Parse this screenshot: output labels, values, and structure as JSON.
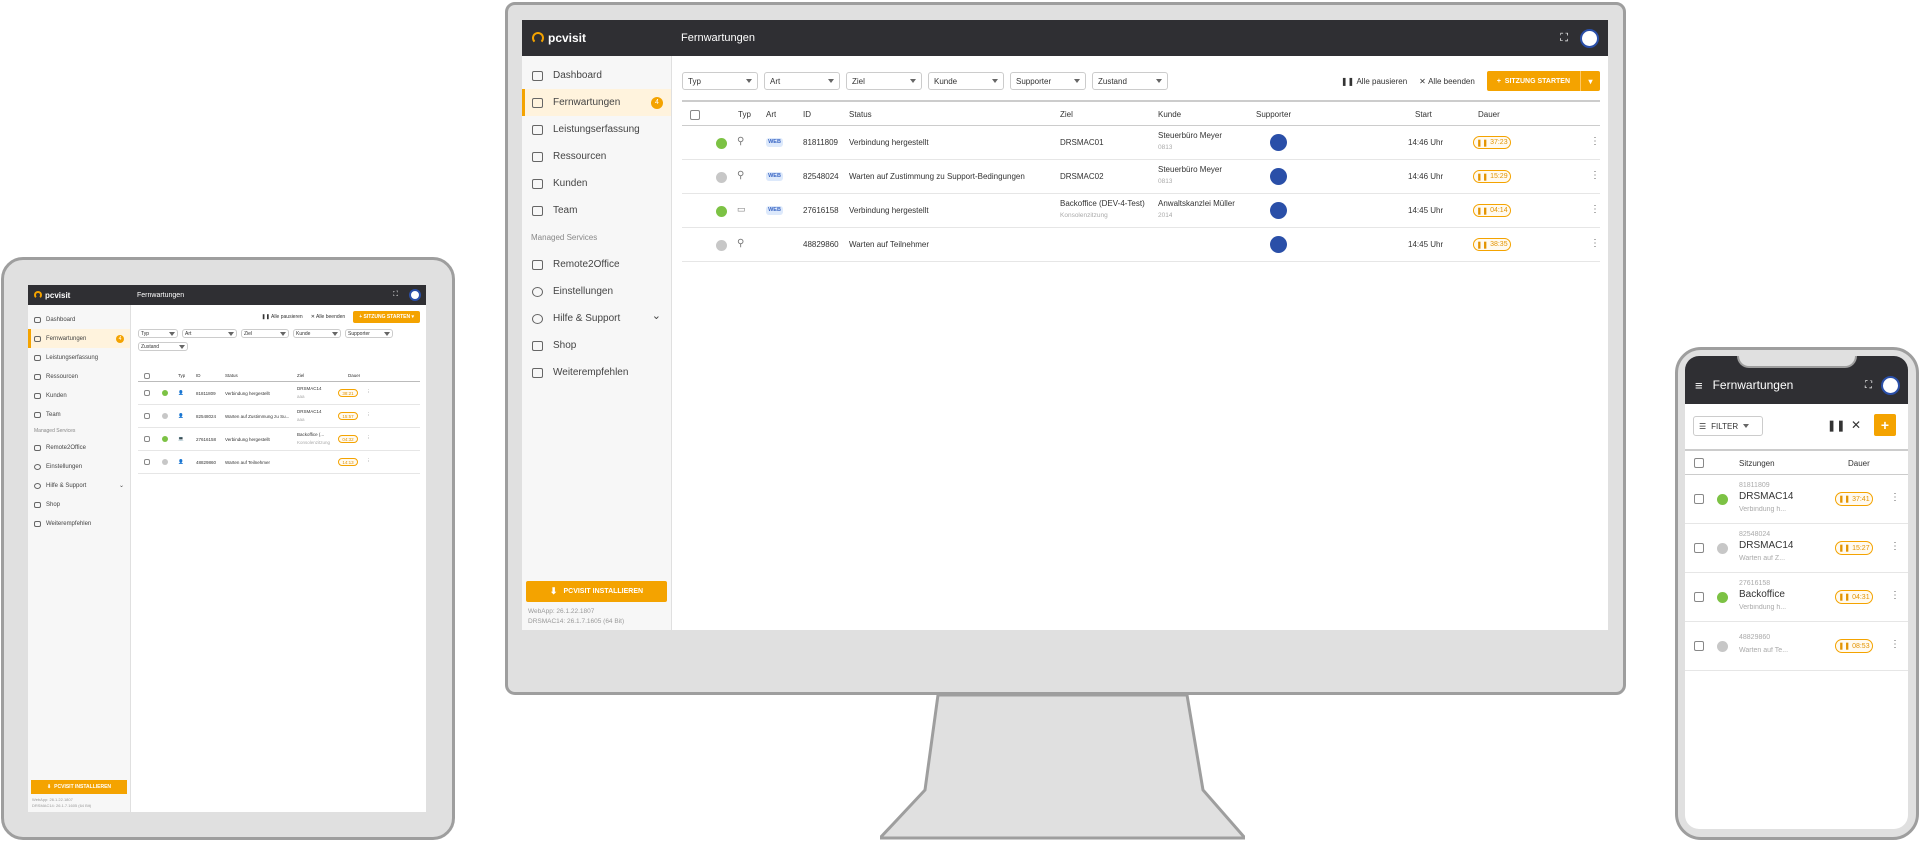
{
  "brand": {
    "name": "pcvisit",
    "accent": "#f4a300",
    "dark": "#2f2f33",
    "online": "#7cc244"
  },
  "page_title": "Fernwartungen",
  "nav": {
    "items": [
      {
        "label": "Dashboard",
        "icon": "dashboard-icon"
      },
      {
        "label": "Fernwartungen",
        "icon": "remote-icon",
        "badge": "4",
        "active": true
      },
      {
        "label": "Leistungserfassung",
        "icon": "timesheet-icon"
      },
      {
        "label": "Ressourcen",
        "icon": "resources-icon"
      },
      {
        "label": "Kunden",
        "icon": "customers-icon"
      },
      {
        "label": "Team",
        "icon": "team-icon"
      }
    ],
    "section_label": "Managed Services",
    "items2": [
      {
        "label": "Remote2Office",
        "icon": "monitor-icon"
      },
      {
        "label": "Einstellungen",
        "icon": "gear-icon"
      },
      {
        "label": "Hilfe & Support",
        "icon": "help-icon"
      },
      {
        "label": "Shop",
        "icon": "cart-icon"
      },
      {
        "label": "Weiterempfehlen",
        "icon": "thumbs-up-icon"
      }
    ],
    "install_button": "PCVISIT INSTALLIEREN",
    "version_line1": "WebApp: 26.1.22.1807",
    "version_line2": "DRSMAC14: 26.1.7.1605 (64 Bit)"
  },
  "filters": {
    "typ": "Typ",
    "art": "Art",
    "ziel": "Ziel",
    "kunde": "Kunde",
    "supporter": "Supporter",
    "zustand": "Zustand"
  },
  "actions": {
    "pause_all": "Alle pausieren",
    "end_all": "Alle beenden",
    "start": "SITZUNG STARTEN"
  },
  "table": {
    "headers": {
      "typ": "Typ",
      "art": "Art",
      "id": "ID",
      "status": "Status",
      "ziel": "Ziel",
      "kunde": "Kunde",
      "supporter": "Supporter",
      "start": "Start",
      "dauer": "Dauer"
    },
    "rows": [
      {
        "state": "online",
        "art": "WEB",
        "id": "81811809",
        "status": "Verbindung hergestellt",
        "ziel": "DRSMAC01",
        "ziel_sub": "",
        "kunde": "Steuerbüro Meyer",
        "kunde_sub": "0813",
        "start": "14:46 Uhr",
        "dauer": "37:23"
      },
      {
        "state": "waiting",
        "art": "WEB",
        "id": "82548024",
        "status": "Warten auf Zustimmung zu Support-Bedingungen",
        "ziel": "DRSMAC02",
        "ziel_sub": "",
        "kunde": "Steuerbüro Meyer",
        "kunde_sub": "0813",
        "start": "14:46 Uhr",
        "dauer": "15:29"
      },
      {
        "state": "online",
        "art": "WEB",
        "id": "27616158",
        "status": "Verbindung hergestellt",
        "ziel": "Backoffice (DEV-4-Test)",
        "ziel_sub": "Konsolenzitzung",
        "kunde": "Anwaltskanzlei Müller",
        "kunde_sub": "2014",
        "start": "14:45 Uhr",
        "dauer": "04:14"
      },
      {
        "state": "waiting",
        "art": "",
        "id": "48829860",
        "status": "Warten auf Teilnehmer",
        "ziel": "",
        "ziel_sub": "",
        "kunde": "",
        "kunde_sub": "",
        "start": "14:45 Uhr",
        "dauer": "38:35"
      }
    ]
  },
  "tablet": {
    "rows": [
      {
        "state": "online",
        "id": "81811809",
        "status": "Verbindung hergestellt",
        "ziel": "DRSMAC14",
        "ziel_sub": "aaa",
        "dauer": "38:21"
      },
      {
        "state": "waiting",
        "id": "82548024",
        "status": "Warten auf Zustimmung zu Su...",
        "ziel": "DRSMAC14",
        "ziel_sub": "aaa",
        "dauer": "15:57"
      },
      {
        "state": "online",
        "id": "27616158",
        "status": "Verbindung hergestellt",
        "ziel": "Backoffice (...",
        "ziel_sub": "Konsolenzitzung",
        "dauer": "04:32"
      },
      {
        "state": "waiting",
        "id": "48829860",
        "status": "Warten auf Teilnehmer",
        "ziel": "",
        "ziel_sub": "",
        "dauer": "14:13"
      }
    ],
    "version_line1": "WebApp: 26.1.22.1807",
    "version_line2": "DRSMAC14: 26.1.7.1605 (64 Bit)"
  },
  "phone": {
    "title": "Fernwartungen",
    "filter": "FILTER",
    "col_sessions": "Sitzungen",
    "col_dauer": "Dauer",
    "rows": [
      {
        "state": "online",
        "id": "81811809",
        "name": "DRSMAC14",
        "status": "Verbindung h...",
        "dauer": "37:41"
      },
      {
        "state": "waiting",
        "id": "82548024",
        "name": "DRSMAC14",
        "status": "Warten auf Z...",
        "dauer": "15:27"
      },
      {
        "state": "online",
        "id": "27616158",
        "name": "Backoffice",
        "status": "Verbindung h...",
        "dauer": "04:31"
      },
      {
        "state": "waiting",
        "id": "48829860",
        "name": "",
        "status": "Warten auf Te...",
        "dauer": "08:53"
      }
    ]
  }
}
